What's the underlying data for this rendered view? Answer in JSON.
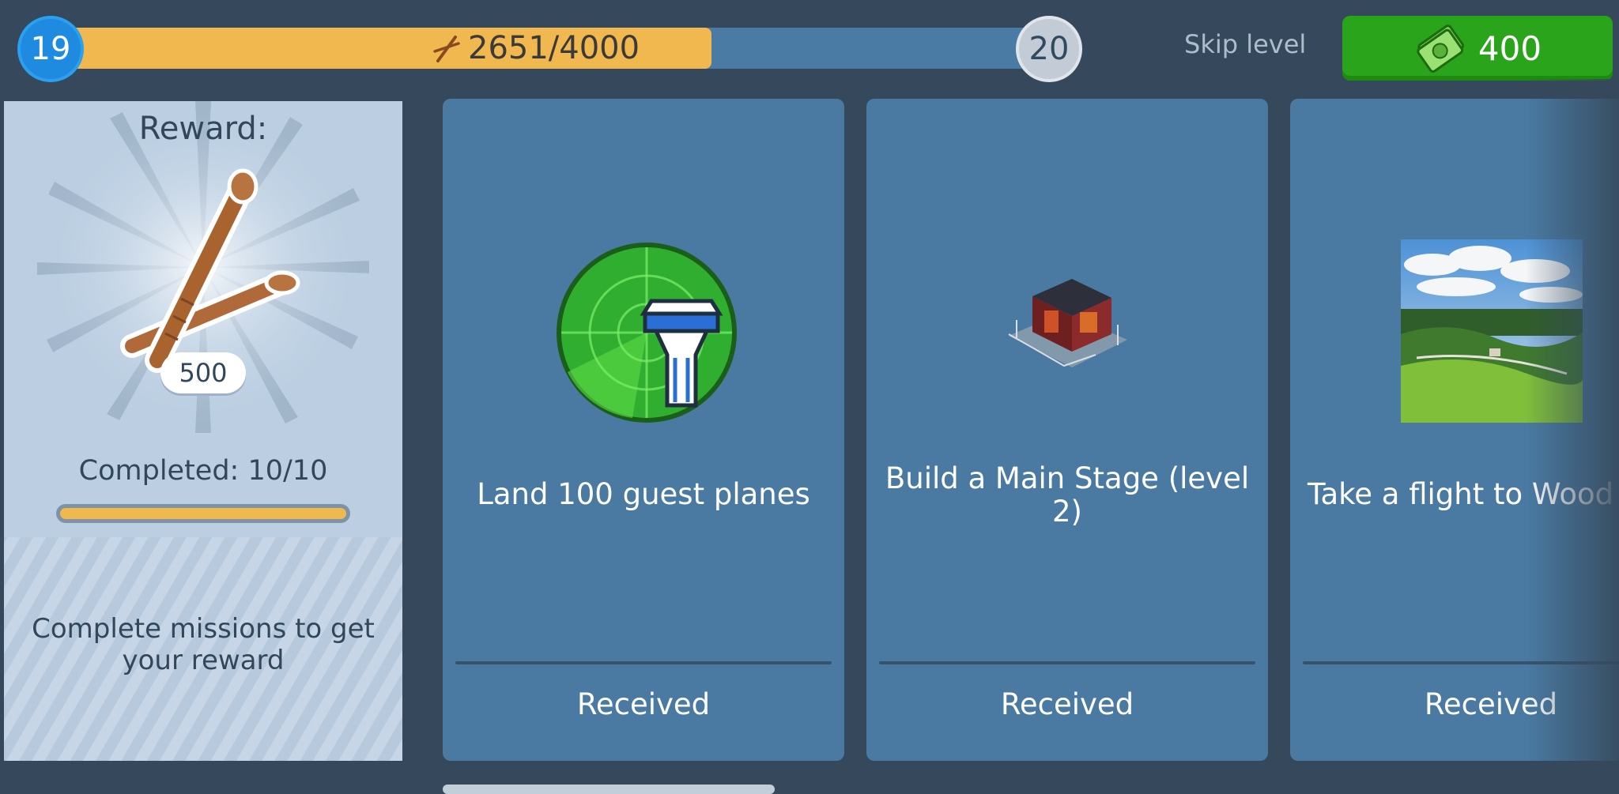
{
  "level": {
    "current": "19",
    "next": "20",
    "progress_text": "2651/4000",
    "progress_fraction": 0.663
  },
  "skip": {
    "label": "Skip level",
    "cost": "400"
  },
  "reward": {
    "title": "Reward:",
    "count": "500",
    "completed": "Completed: 10/10",
    "completed_fraction": 1.0,
    "hint": "Complete missions to get your reward"
  },
  "missions": [
    {
      "text": "Land 100 guest planes",
      "status": "Received"
    },
    {
      "text": "Build a Main Stage (level 2)",
      "status": "Received"
    },
    {
      "text": "Take a flight to Wood",
      "status": "Received"
    }
  ],
  "colors": {
    "background": "#36495c",
    "progress_fill": "#f1b84f",
    "card": "#4a7aa2",
    "skip_button": "#2aa41a",
    "level_badge": "#1f8be0"
  },
  "icons": [
    "drumsticks-icon",
    "cash-icon",
    "control-tower-icon",
    "main-stage-icon",
    "landscape-icon"
  ]
}
